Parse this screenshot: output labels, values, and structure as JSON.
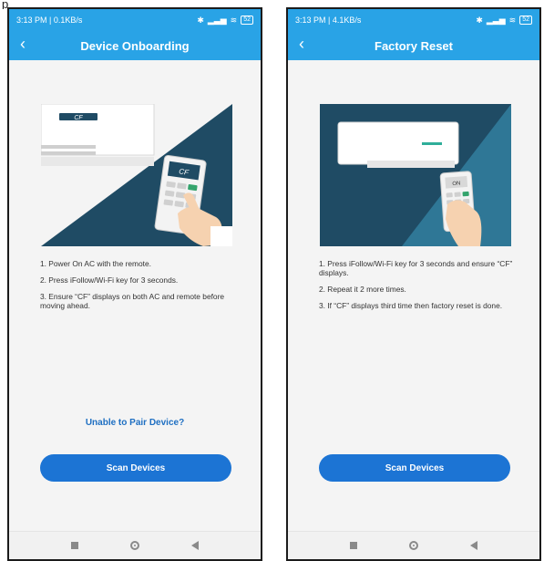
{
  "top_fragment": "p",
  "left": {
    "status": {
      "time": "3:13 PM | 0.1KB/s",
      "battery": "52"
    },
    "title": "Device Onboarding",
    "back_icon": "chevron-left-icon",
    "illustration_label": "CF",
    "remote_display": "CF",
    "steps": [
      "1. Power On AC with the remote.",
      "2. Press iFollow/Wi-Fi key for 3 seconds.",
      "3. Ensure “CF” displays on both AC and remote before moving ahead."
    ],
    "link": "Unable to Pair Device?",
    "button": "Scan Devices"
  },
  "right": {
    "status": {
      "time": "3:13 PM | 4.1KB/s",
      "battery": "52"
    },
    "title": "Factory Reset",
    "back_icon": "chevron-left-icon",
    "remote_display": "ON",
    "steps": [
      "1. Press iFollow/Wi-Fi key for 3 seconds and ensure “CF” displays.",
      "2. Repeat it 2 more times.",
      "3. If “CF” displays third time then factory reset is done."
    ],
    "button": "Scan Devices"
  },
  "colors": {
    "header": "#29a3e6",
    "button": "#1c74d4",
    "link": "#1e6fc2",
    "illustration_dark": "#1f4b64",
    "illustration_light": "#2f7796"
  }
}
